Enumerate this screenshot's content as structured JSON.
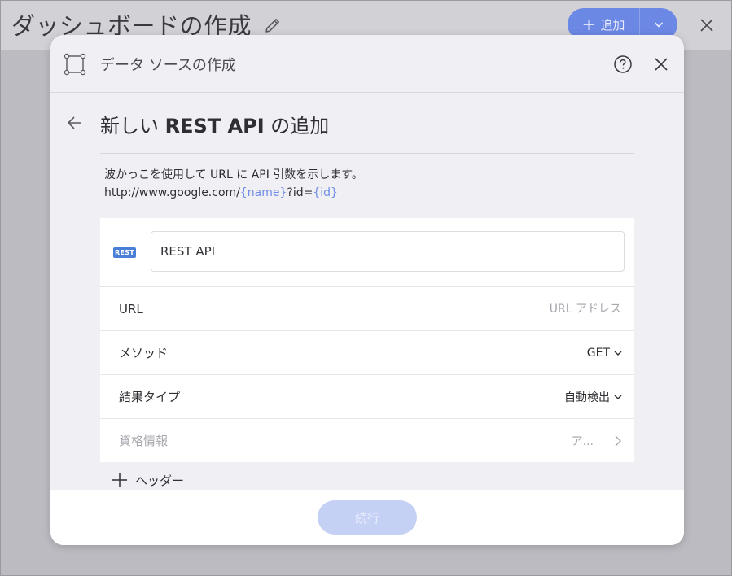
{
  "topbar": {
    "title": "ダッシュボードの作成",
    "add_label": "追加"
  },
  "modal": {
    "title": "データ ソースの作成"
  },
  "page": {
    "heading_prefix": "新しい",
    "heading_bold": "REST API",
    "heading_suffix": "の追加",
    "instruction_line1": "波かっこを使用して URL に API 引数を示します。",
    "example_url_base": "http://www.google.com/",
    "example_param_name": "{name}",
    "example_url_mid": "?id=",
    "example_param_id": "{id}"
  },
  "form": {
    "badge": "REST",
    "name_value": "REST API",
    "url_label": "URL",
    "url_placeholder": "URL アドレス",
    "method_label": "メソッド",
    "method_value": "GET",
    "result_type_label": "結果タイプ",
    "result_type_value": "自動検出",
    "credentials_label": "資格情報",
    "credentials_value": "ア..."
  },
  "actions": {
    "add_header_label": "ヘッダー",
    "continue_label": "続行"
  },
  "colors": {
    "accent": "#6b88e4",
    "param_highlight": "#6f8de6",
    "rest_badge": "#4a7fd8",
    "continue_disabled": "#c5d0f5"
  }
}
